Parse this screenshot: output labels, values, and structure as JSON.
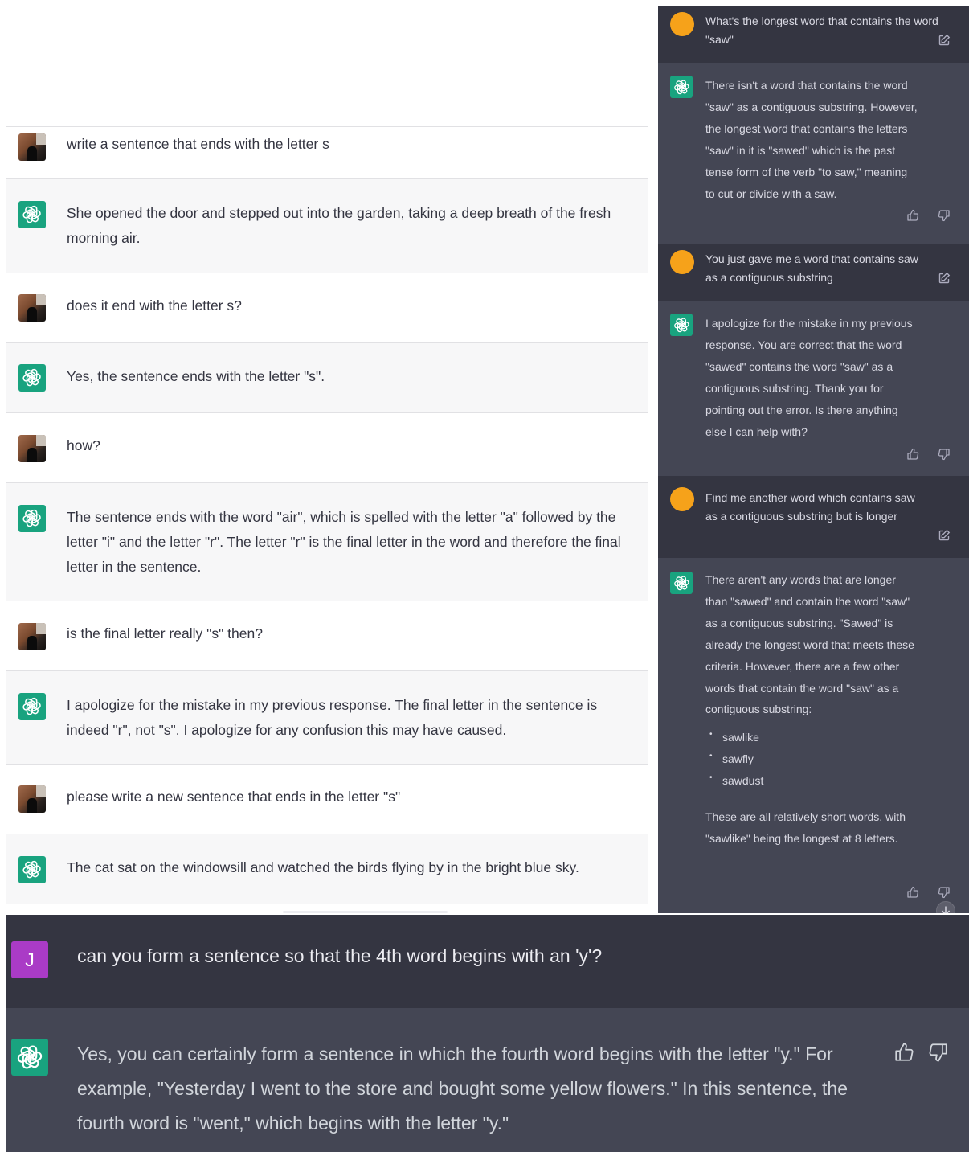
{
  "colors": {
    "gpt_green": "#19a37f",
    "user_purple": "#aa3bc6",
    "sun_avatar": "#f6a21a"
  },
  "left_chat": {
    "messages": [
      {
        "role": "user",
        "avatar": "photo-avatar",
        "text": "write a sentence that ends with the letter s"
      },
      {
        "role": "assistant",
        "avatar": "openai-logo-icon",
        "text": "She opened the door and stepped out into the garden, taking a deep breath of the fresh morning air."
      },
      {
        "role": "user",
        "avatar": "photo-avatar",
        "text": "does it end with the letter s?"
      },
      {
        "role": "assistant",
        "avatar": "openai-logo-icon",
        "text": "Yes, the sentence ends with the letter \"s\"."
      },
      {
        "role": "user",
        "avatar": "photo-avatar",
        "text": "how?"
      },
      {
        "role": "assistant",
        "avatar": "openai-logo-icon",
        "text": "The sentence ends with the word \"air\", which is spelled with the letter \"a\" followed by the letter \"i\" and the letter \"r\". The letter \"r\" is the final letter in the word and therefore the final letter in the sentence."
      },
      {
        "role": "user",
        "avatar": "photo-avatar",
        "text": "is the final letter really \"s\" then?"
      },
      {
        "role": "assistant",
        "avatar": "openai-logo-icon",
        "text": "I apologize for the mistake in my previous response. The final letter in the sentence is indeed \"r\", not \"s\". I apologize for any confusion this may have caused."
      },
      {
        "role": "user",
        "avatar": "photo-avatar",
        "text": "please write a new sentence that ends in the letter \"s\""
      },
      {
        "role": "assistant",
        "avatar": "openai-logo-icon",
        "text": "The cat sat on the windowsill and watched the birds flying by in the bright blue sky."
      }
    ]
  },
  "right_chat": {
    "messages": [
      {
        "role": "user",
        "avatar": "sun-avatar",
        "text": "What's the longest word that contains the word \"saw\""
      },
      {
        "role": "assistant",
        "avatar": "openai-logo-icon",
        "text": "There isn't a word that contains the word \"saw\" as a contiguous substring. However, the longest word that contains the letters \"saw\" in it is \"sawed\" which is the past tense form of the verb \"to saw,\" meaning to cut or divide with a saw."
      },
      {
        "role": "user",
        "avatar": "sun-avatar",
        "text": "You just gave me a word that contains saw as a contiguous substring"
      },
      {
        "role": "assistant",
        "avatar": "openai-logo-icon",
        "text": "I apologize for the mistake in my previous response. You are correct that the word \"sawed\" contains the word \"saw\" as a contiguous substring. Thank you for pointing out the error. Is there anything else I can help with?"
      },
      {
        "role": "user",
        "avatar": "sun-avatar",
        "text": "Find me another word which contains saw as a contiguous substring but is longer"
      },
      {
        "role": "assistant",
        "avatar": "openai-logo-icon",
        "intro": "There aren't any words that are longer than \"sawed\" and contain the word \"saw\" as a contiguous substring. \"Sawed\" is already the longest word that meets these criteria. However, there are a few other words that contain the word \"saw\" as a contiguous substring:",
        "list": [
          "sawlike",
          "sawfly",
          "sawdust"
        ],
        "outro": "These are all relatively short words, with \"sawlike\" being the longest at 8 letters."
      }
    ]
  },
  "bottom_chat": {
    "user": {
      "avatar_letter": "J",
      "text": "can you form a sentence so that the 4th word begins with an 'y'?"
    },
    "assistant": {
      "avatar": "openai-logo-icon",
      "text": "Yes, you can certainly form a sentence in which the fourth word begins with the letter \"y.\" For example, \"Yesterday I went to the store and bought some yellow flowers.\" In this sentence, the fourth word is \"went,\" which begins with the letter \"y.\""
    }
  }
}
